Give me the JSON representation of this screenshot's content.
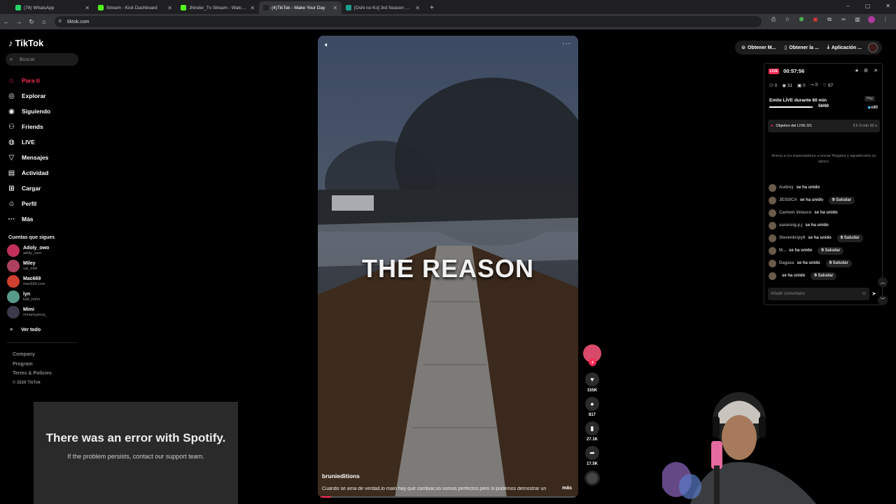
{
  "browser": {
    "tabs": [
      {
        "label": "(78) WhatsApp",
        "color": "#25d366"
      },
      {
        "label": "Stream - Kick Dashboard",
        "color": "#53fc18"
      },
      {
        "label": "Jhinder_Tv Stream - Watch Live",
        "color": "#53fc18"
      },
      {
        "label": "(4)TikTok - Make Your Day",
        "color": "#222222",
        "active": true
      },
      {
        "label": "[Oshi no Ko] 3rd Season Episod",
        "color": "#1a9f8f"
      }
    ],
    "url": "tiktok.com"
  },
  "sidebar": {
    "logo": "TikTok",
    "search_placeholder": "Buscar",
    "nav": [
      {
        "label": "Para ti",
        "icon": "home-icon",
        "active": true
      },
      {
        "label": "Explorar",
        "icon": "compass-icon"
      },
      {
        "label": "Siguiendo",
        "icon": "following-icon"
      },
      {
        "label": "Friends",
        "icon": "friends-icon"
      },
      {
        "label": "LIVE",
        "icon": "live-icon"
      },
      {
        "label": "Mensajes",
        "icon": "messages-icon"
      },
      {
        "label": "Actividad",
        "icon": "activity-icon"
      },
      {
        "label": "Cargar",
        "icon": "upload-icon"
      },
      {
        "label": "Perfil",
        "icon": "profile-icon"
      },
      {
        "label": "Más",
        "icon": "more-icon"
      }
    ],
    "following_header": "Cuentas que sigues",
    "accounts": [
      {
        "name": "Adoly_owo",
        "handle": "adoly_owo",
        "color": "#c0305a"
      },
      {
        "name": "Miley",
        "handle": "ual_mile",
        "color": "#b04060"
      },
      {
        "name": "Mac669",
        "handle": "mac669.com",
        "color": "#d04030"
      },
      {
        "name": "lyn",
        "handle": "ka8_hoho",
        "color": "#5a9a8a"
      },
      {
        "name": "Mimi",
        "handle": "miriamyanza_",
        "color": "#3a3a4a"
      }
    ],
    "see_all": "Ver todo",
    "footer": [
      "Company",
      "Program",
      "Terms & Policies"
    ],
    "copyright": "© 2026 TikTok"
  },
  "spotify": {
    "title": "There was an error with Spotify.",
    "subtitle": "If the problem persists, contact our support team."
  },
  "video": {
    "title": "THE REASON",
    "author": "brunieditions",
    "description": "Cuando se ama de verdad,lo malo hay que cambiar,no somos perfectos pero si podemos demostrar un",
    "more": "más",
    "progress": 0.05,
    "likes": "155K",
    "comments": "817",
    "saves": "27.1K",
    "shares": "17.5K"
  },
  "topbar": {
    "buttons": [
      "Obtener M...",
      "Obtener la ...",
      "Aplicación ..."
    ]
  },
  "live_panel": {
    "badge": "LIVE",
    "timer": "00:57:56",
    "stats": [
      "0",
      "31",
      "0",
      "0",
      "97"
    ],
    "goal_title": "Emite LIVE durante 60 min",
    "goal_count": "56/60",
    "goal_progress": 0.93,
    "today": "Hoy",
    "reward": "x80",
    "objective": "Objetivo del LIVE 0/1",
    "objective_time": "3 h 0 min 50 s",
    "hint": "Anima a los espectadores a enviar Regalos y agradéceles su apoyo.",
    "joined_text": "se ha unido",
    "greet_label": "Saludar",
    "feed": [
      {
        "name": "Audrey",
        "greet": false
      },
      {
        "name": "JESSICA",
        "greet": true
      },
      {
        "name": "Carmen Velasco",
        "greet": false
      },
      {
        "name": "saransig.p.j",
        "greet": false
      },
      {
        "name": "Stevenkripy6",
        "greet": true
      },
      {
        "name": "M...",
        "greet": true
      },
      {
        "name": "Dagasa",
        "greet": true
      },
      {
        "name": "",
        "greet": true
      }
    ],
    "comment_placeholder": "Añadir comentario"
  }
}
